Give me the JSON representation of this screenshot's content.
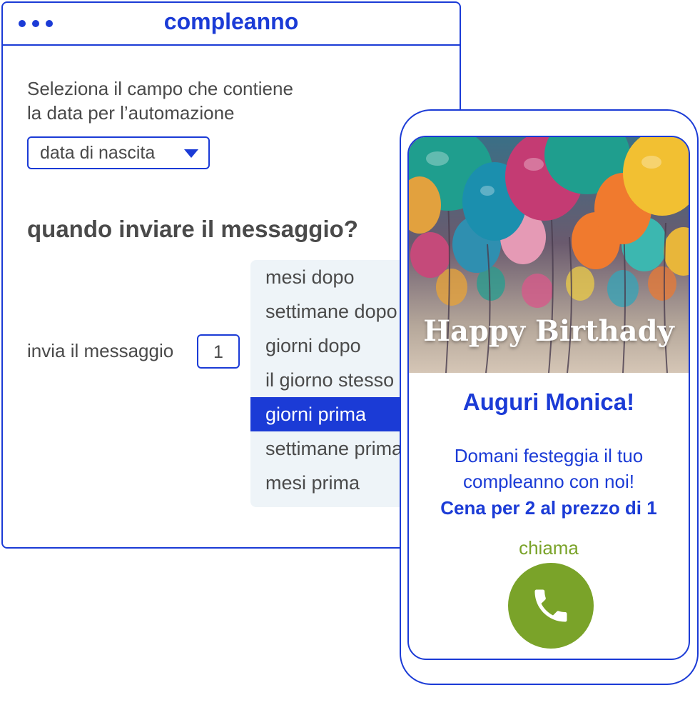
{
  "window": {
    "title": "compleanno",
    "field_label_line1": "Seleziona il campo che contiene",
    "field_label_line2": "la data per l’automazione",
    "field_select_value": "data di nascita",
    "question": "quando inviare il messaggio?",
    "send_label": "invia il messaggio",
    "send_value": "1",
    "dropdown_options": [
      "mesi dopo",
      "settimane dopo",
      "giorni dopo",
      "il giorno stesso",
      "giorni prima",
      "settimane prima",
      "mesi prima"
    ],
    "dropdown_selected": "giorni prima"
  },
  "phone": {
    "hero_text": "Happy Birthady",
    "greeting": "Auguri Monica!",
    "message_line1": "Domani festeggia il tuo",
    "message_line2": "compleanno con noi!",
    "offer": "Cena per 2 al prezzo di 1",
    "call_label": "chiama",
    "call_icon": "phone-icon"
  },
  "colors": {
    "accent": "#1b3bd6",
    "text": "#4a4a4a",
    "dropdown_bg": "#eef4f8",
    "call_green": "#7aa329"
  }
}
